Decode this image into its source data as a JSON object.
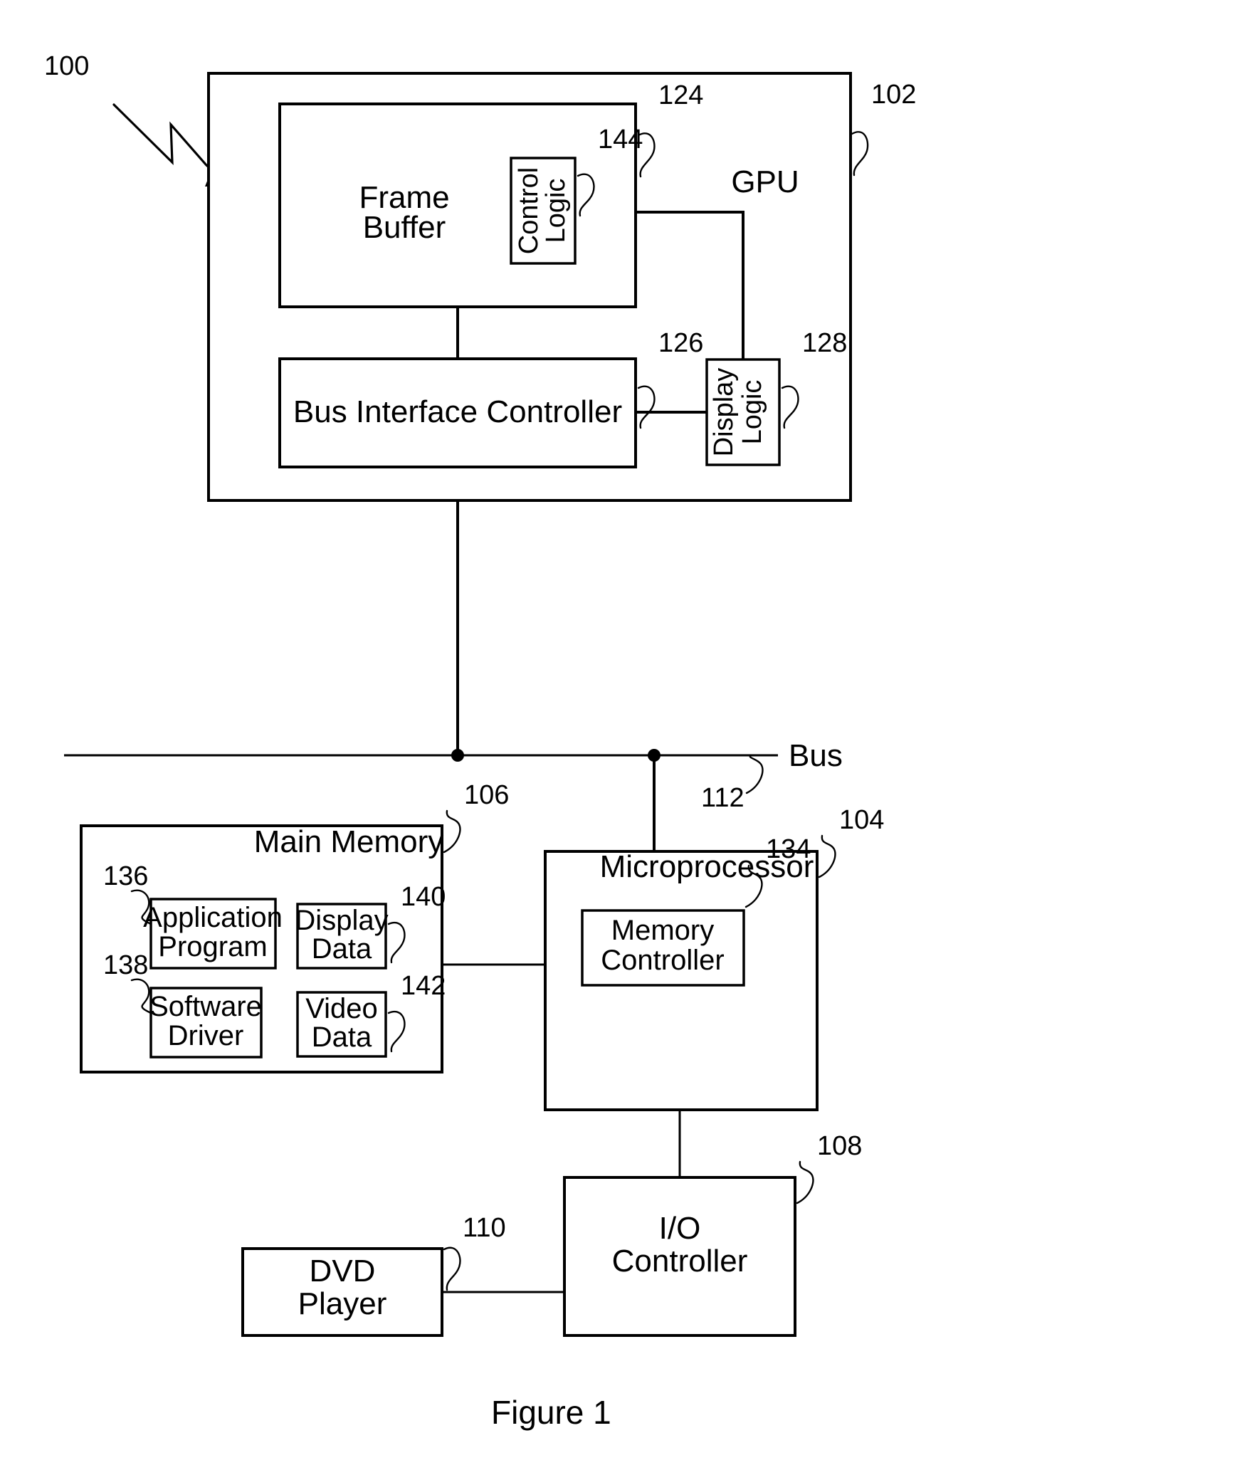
{
  "figure": {
    "caption": "Figure 1",
    "system_ref": "100"
  },
  "gpu": {
    "title": "GPU",
    "ref": "102",
    "blocks": {
      "frame_buffer": {
        "line1": "Frame",
        "line2": "Buffer",
        "ref": "124"
      },
      "control_logic": {
        "line1": "Control",
        "line2": "Logic",
        "ref": "144"
      },
      "bus_interface_controller": {
        "label": "Bus Interface Controller",
        "ref": "126"
      },
      "display_logic": {
        "line1": "Display",
        "line2": "Logic",
        "ref": "128"
      }
    }
  },
  "bus": {
    "label": "Bus",
    "ref": "112"
  },
  "main_memory": {
    "title": "Main Memory",
    "ref": "106",
    "blocks": {
      "application_program": {
        "line1": "Application",
        "line2": "Program",
        "ref": "136"
      },
      "software_driver": {
        "line1": "Software",
        "line2": "Driver",
        "ref": "138"
      },
      "display_data": {
        "line1": "Display",
        "line2": "Data",
        "ref": "140"
      },
      "video_data": {
        "line1": "Video",
        "line2": "Data",
        "ref": "142"
      }
    }
  },
  "microprocessor": {
    "title": "Microprocessor",
    "ref": "104",
    "blocks": {
      "memory_controller": {
        "line1": "Memory",
        "line2": "Controller",
        "ref": "134"
      }
    }
  },
  "dvd_player": {
    "line1": "DVD",
    "line2": "Player",
    "ref": "110"
  },
  "io_controller": {
    "line1": "I/O",
    "line2": "Controller",
    "ref": "108"
  },
  "colors": {
    "ink": "#000000",
    "paper": "#ffffff"
  }
}
